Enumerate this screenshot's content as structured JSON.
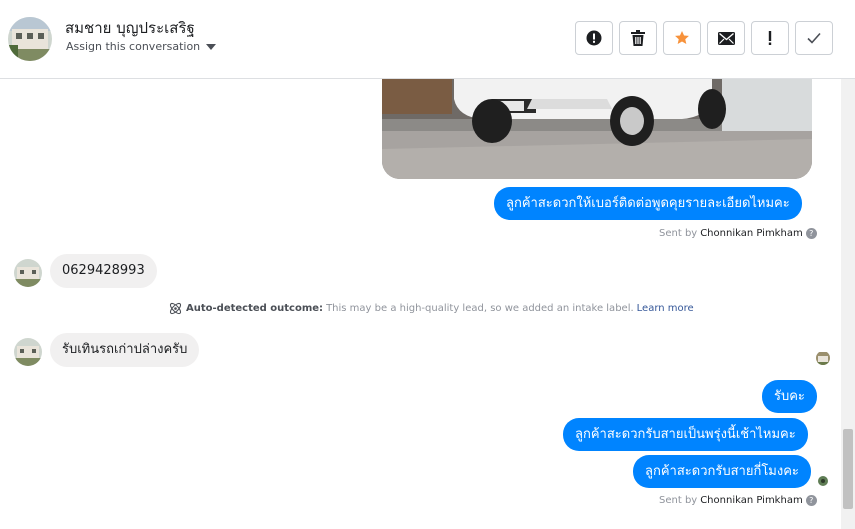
{
  "header": {
    "contact_name": "สมชาย บุญประเสริฐ",
    "assign_label": "Assign this conversation",
    "actions": [
      {
        "name": "report-spam-button",
        "icon": "exclamation-circle-icon"
      },
      {
        "name": "delete-button",
        "icon": "trash-icon"
      },
      {
        "name": "star-button",
        "icon": "star-icon"
      },
      {
        "name": "mark-unread-button",
        "icon": "envelope-icon"
      },
      {
        "name": "follow-up-button",
        "icon": "exclamation-icon"
      },
      {
        "name": "mark-done-button",
        "icon": "check-icon"
      }
    ]
  },
  "thread": {
    "messages": {
      "out_1": "ลูกค้าสะดวกให้เบอร์ติดต่อพูดคุยรายละเอียดไหมคะ",
      "in_1": "0629428993",
      "in_2": "รับเทินรถเก่าปล่างครับ",
      "out_2": "รับคะ",
      "out_3": "ลูกค้าสะดวกรับสายเป็นพรุ่งนี้เช้าไหมคะ",
      "out_4": "ลูกค้าสะดวกรับสายกี่โมงคะ"
    },
    "sent_by_prefix": "Sent by",
    "agent_name": "Chonnikan Pimkham",
    "help_glyph": "?",
    "outcome": {
      "label": "Auto-detected outcome:",
      "text": "This may be a high-quality lead, so we added an intake label.",
      "link": "Learn more"
    }
  },
  "colors": {
    "outgoing_bubble": "#0084ff",
    "incoming_bubble": "#f1f0f0",
    "star": "#f7923b",
    "link": "#365899"
  }
}
